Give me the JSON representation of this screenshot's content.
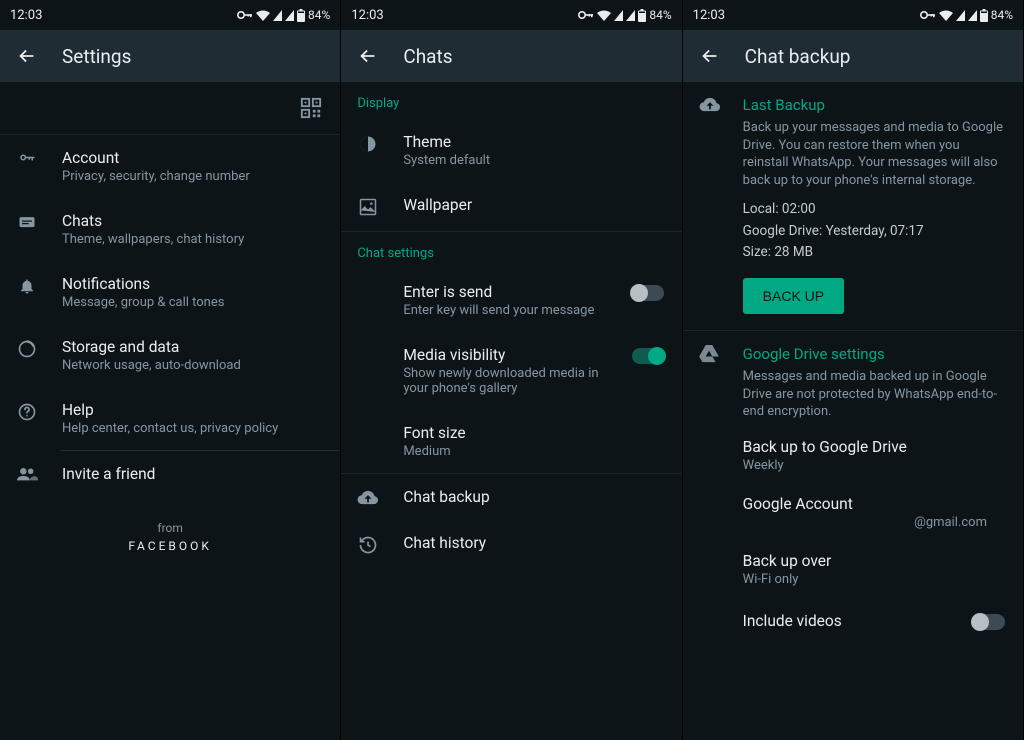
{
  "status": {
    "time": "12:03",
    "battery": "84%"
  },
  "panels": {
    "settings": {
      "title": "Settings",
      "items": {
        "account": {
          "title": "Account",
          "sub": "Privacy, security, change number"
        },
        "chats": {
          "title": "Chats",
          "sub": "Theme, wallpapers, chat history"
        },
        "notif": {
          "title": "Notifications",
          "sub": "Message, group & call tones"
        },
        "storage": {
          "title": "Storage and data",
          "sub": "Network usage, auto-download"
        },
        "help": {
          "title": "Help",
          "sub": "Help center, contact us, privacy policy"
        },
        "invite": {
          "title": "Invite a friend"
        }
      },
      "from": "from",
      "facebook": "FACEBOOK"
    },
    "chats": {
      "title": "Chats",
      "display_label": "Display",
      "theme": {
        "title": "Theme",
        "sub": "System default"
      },
      "wallpaper": "Wallpaper",
      "chat_settings_label": "Chat settings",
      "enter": {
        "title": "Enter is send",
        "sub": "Enter key will send your message"
      },
      "media": {
        "title": "Media visibility",
        "sub": "Show newly downloaded media in your phone's gallery"
      },
      "font": {
        "title": "Font size",
        "sub": "Medium"
      },
      "backup": "Chat backup",
      "history": "Chat history"
    },
    "backup": {
      "title": "Chat backup",
      "last_title": "Last Backup",
      "last_desc": "Back up your messages and media to Google Drive. You can restore them when you reinstall WhatsApp. Your messages will also back up to your phone's internal storage.",
      "local": "Local: 02:00",
      "gdrive_time": "Google Drive: Yesterday, 07:17",
      "size": "Size: 28 MB",
      "button": "BACK UP",
      "gdrive_title": "Google Drive settings",
      "gdrive_desc": "Messages and media backed up in Google Drive are not protected by WhatsApp end-to-end encryption.",
      "items": {
        "frequency": {
          "title": "Back up to Google Drive",
          "sub": "Weekly"
        },
        "account": {
          "title": "Google Account",
          "sub": "@gmail.com"
        },
        "over": {
          "title": "Back up over",
          "sub": "Wi-Fi only"
        },
        "videos": {
          "title": "Include videos"
        }
      }
    }
  }
}
